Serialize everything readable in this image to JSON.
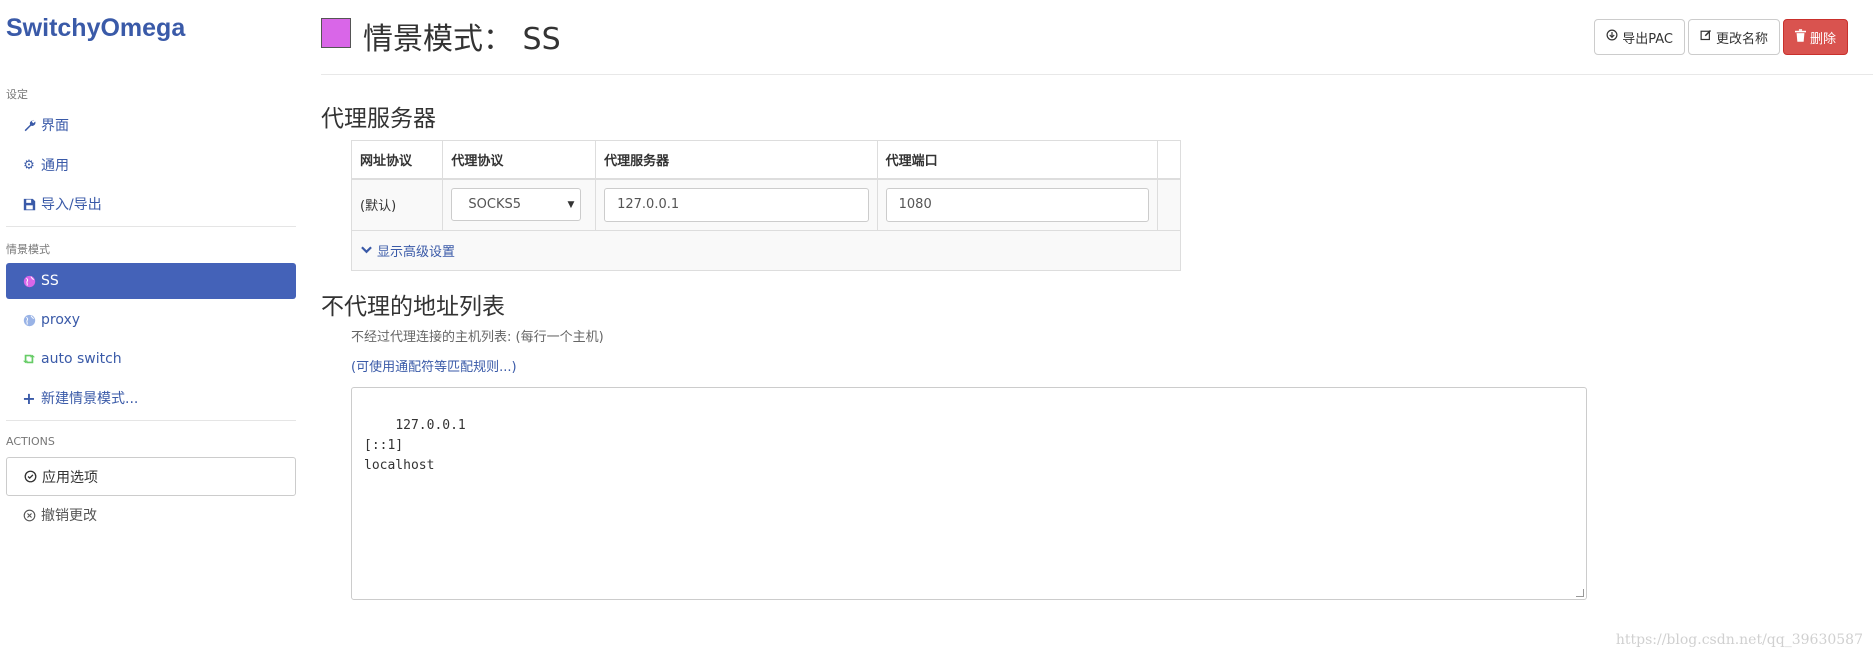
{
  "app": {
    "name": "SwitchyOmega"
  },
  "sidebar": {
    "settings_header": "设定",
    "settings_items": [
      {
        "label": "界面",
        "icon": "wrench-icon"
      },
      {
        "label": "通用",
        "icon": "gear-icon"
      },
      {
        "label": "导入/导出",
        "icon": "floppy-icon"
      }
    ],
    "profiles_header": "情景模式",
    "profiles": [
      {
        "label": "SS",
        "icon": "globe-icon",
        "color": "#d966e8",
        "active": true
      },
      {
        "label": "proxy",
        "icon": "globe-icon",
        "color": "#99b3e6"
      },
      {
        "label": "auto switch",
        "icon": "retweet-icon",
        "color": "#66cc66"
      },
      {
        "label": "新建情景模式...",
        "icon": "plus-icon"
      }
    ],
    "actions_header": "ACTIONS",
    "apply_label": "应用选项",
    "discard_label": "撤销更改"
  },
  "header": {
    "title": "情景模式： SS",
    "profile_color": "#d966e8",
    "export_pac_label": "导出PAC",
    "rename_label": "更改名称",
    "delete_label": "删除"
  },
  "proxy_section": {
    "title": "代理服务器",
    "columns": [
      "网址协议",
      "代理协议",
      "代理服务器",
      "代理端口"
    ],
    "row": {
      "scheme": "(默认)",
      "protocol": "SOCKS5",
      "server": "127.0.0.1",
      "port": "1080"
    },
    "advanced_label": "显示高级设置"
  },
  "bypass_section": {
    "title": "不代理的地址列表",
    "help_text": "不经过代理连接的主机列表: (每行一个主机)",
    "rules_link": "(可使用通配符等匹配规则...)",
    "bypass_list": "127.0.0.1\n[::1]\nlocalhost"
  },
  "watermark": "https://blog.csdn.net/qq_39630587",
  "colors": {
    "accent": "#4462b8",
    "danger": "#d9534f",
    "link": "#3a5aa8"
  }
}
